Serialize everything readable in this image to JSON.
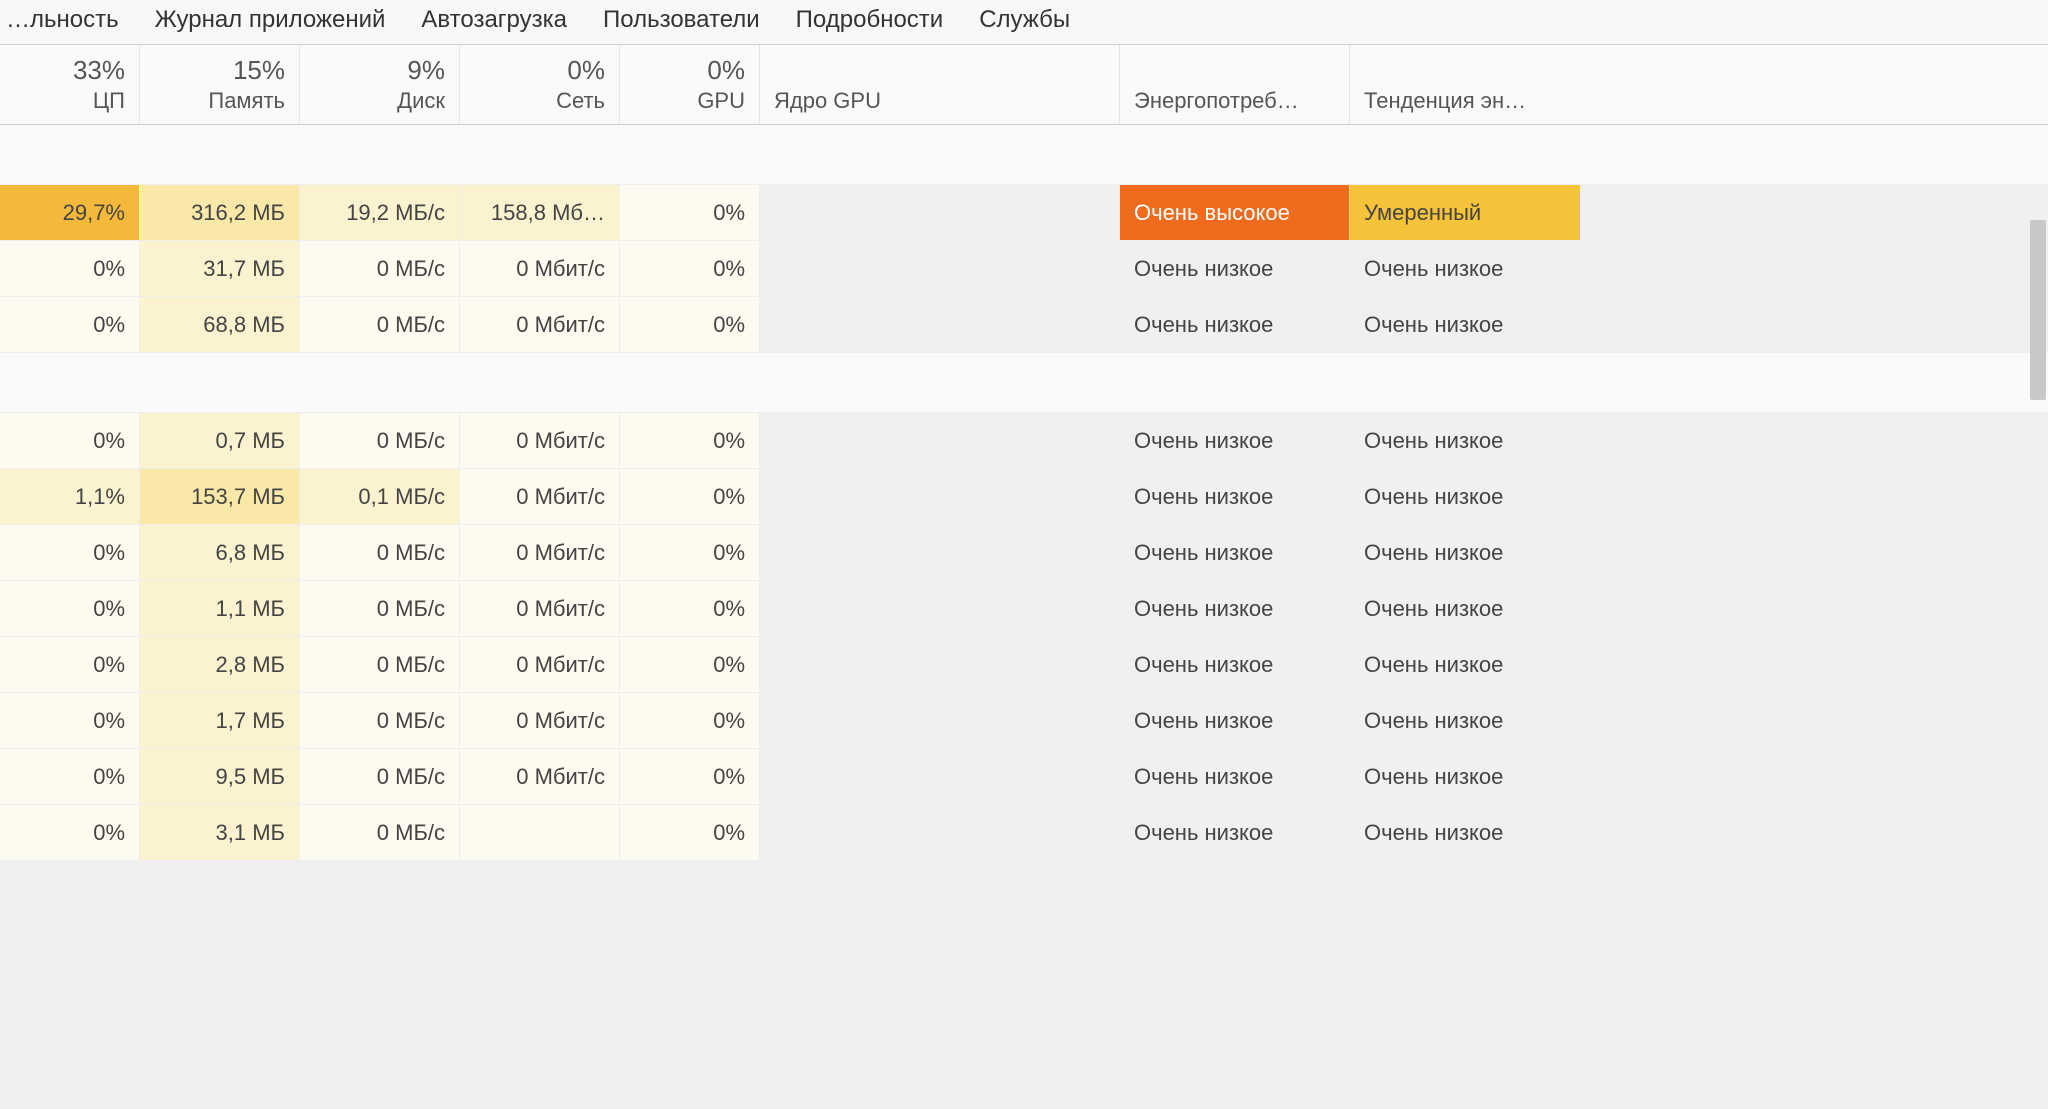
{
  "tabs": [
    "…льность",
    "Журнал приложений",
    "Автозагрузка",
    "Пользователи",
    "Подробности",
    "Службы"
  ],
  "columns": {
    "cpu": {
      "percent": "33%",
      "label": "ЦП"
    },
    "mem": {
      "percent": "15%",
      "label": "Память"
    },
    "disk": {
      "percent": "9%",
      "label": "Диск"
    },
    "net": {
      "percent": "0%",
      "label": "Сеть"
    },
    "gpu": {
      "percent": "0%",
      "label": "GPU"
    },
    "gpucore": {
      "label": "Ядро GPU"
    },
    "power": {
      "label": "Энергопотреб…"
    },
    "trend": {
      "label": "Тенденция эн…"
    }
  },
  "rows": [
    {
      "cpu": "29,7%",
      "cpu_heat": 4,
      "mem": "316,2 МБ",
      "mem_heat": 2,
      "disk": "19,2 МБ/с",
      "disk_heat": 1,
      "net": "158,8 Мб…",
      "net_heat": 1,
      "gpu": "0%",
      "power": "Очень высокое",
      "power_class": "heat-hi",
      "trend": "Умеренный",
      "trend_class": "heat-mod"
    },
    {
      "cpu": "0%",
      "cpu_heat": 0,
      "mem": "31,7 МБ",
      "mem_heat": 1,
      "disk": "0 МБ/с",
      "disk_heat": 0,
      "net": "0 Мбит/с",
      "net_heat": 0,
      "gpu": "0%",
      "power": "Очень низкое",
      "power_class": "",
      "trend": "Очень низкое",
      "trend_class": ""
    },
    {
      "cpu": "0%",
      "cpu_heat": 0,
      "mem": "68,8 МБ",
      "mem_heat": 1,
      "disk": "0 МБ/с",
      "disk_heat": 0,
      "net": "0 Мбит/с",
      "net_heat": 0,
      "gpu": "0%",
      "power": "Очень низкое",
      "power_class": "",
      "trend": "Очень низкое",
      "trend_class": ""
    },
    {
      "_gap": true
    },
    {
      "cpu": "0%",
      "cpu_heat": 0,
      "mem": "0,7 МБ",
      "mem_heat": 1,
      "disk": "0 МБ/с",
      "disk_heat": 0,
      "net": "0 Мбит/с",
      "net_heat": 0,
      "gpu": "0%",
      "power": "Очень низкое",
      "power_class": "",
      "trend": "Очень низкое",
      "trend_class": ""
    },
    {
      "cpu": "1,1%",
      "cpu_heat": 1,
      "mem": "153,7 МБ",
      "mem_heat": 2,
      "disk": "0,1 МБ/с",
      "disk_heat": 1,
      "net": "0 Мбит/с",
      "net_heat": 0,
      "gpu": "0%",
      "power": "Очень низкое",
      "power_class": "",
      "trend": "Очень низкое",
      "trend_class": ""
    },
    {
      "cpu": "0%",
      "cpu_heat": 0,
      "mem": "6,8 МБ",
      "mem_heat": 1,
      "disk": "0 МБ/с",
      "disk_heat": 0,
      "net": "0 Мбит/с",
      "net_heat": 0,
      "gpu": "0%",
      "power": "Очень низкое",
      "power_class": "",
      "trend": "Очень низкое",
      "trend_class": ""
    },
    {
      "cpu": "0%",
      "cpu_heat": 0,
      "mem": "1,1 МБ",
      "mem_heat": 1,
      "disk": "0 МБ/с",
      "disk_heat": 0,
      "net": "0 Мбит/с",
      "net_heat": 0,
      "gpu": "0%",
      "power": "Очень низкое",
      "power_class": "",
      "trend": "Очень низкое",
      "trend_class": ""
    },
    {
      "cpu": "0%",
      "cpu_heat": 0,
      "mem": "2,8 МБ",
      "mem_heat": 1,
      "disk": "0 МБ/с",
      "disk_heat": 0,
      "net": "0 Мбит/с",
      "net_heat": 0,
      "gpu": "0%",
      "power": "Очень низкое",
      "power_class": "",
      "trend": "Очень низкое",
      "trend_class": ""
    },
    {
      "cpu": "0%",
      "cpu_heat": 0,
      "mem": "1,7 МБ",
      "mem_heat": 1,
      "disk": "0 МБ/с",
      "disk_heat": 0,
      "net": "0 Мбит/с",
      "net_heat": 0,
      "gpu": "0%",
      "power": "Очень низкое",
      "power_class": "",
      "trend": "Очень низкое",
      "trend_class": ""
    },
    {
      "cpu": "0%",
      "cpu_heat": 0,
      "mem": "9,5 МБ",
      "mem_heat": 1,
      "disk": "0 МБ/с",
      "disk_heat": 0,
      "net": "0 Мбит/с",
      "net_heat": 0,
      "gpu": "0%",
      "power": "Очень низкое",
      "power_class": "",
      "trend": "Очень низкое",
      "trend_class": ""
    },
    {
      "cpu": "0%",
      "cpu_heat": 0,
      "mem": "3,1 МБ",
      "mem_heat": 1,
      "disk": "0 МБ/с",
      "disk_heat": 0,
      "net": "",
      "net_heat": 0,
      "gpu": "0%",
      "power": "Очень низкое",
      "power_class": "",
      "trend": "Очень низкое",
      "trend_class": ""
    }
  ]
}
